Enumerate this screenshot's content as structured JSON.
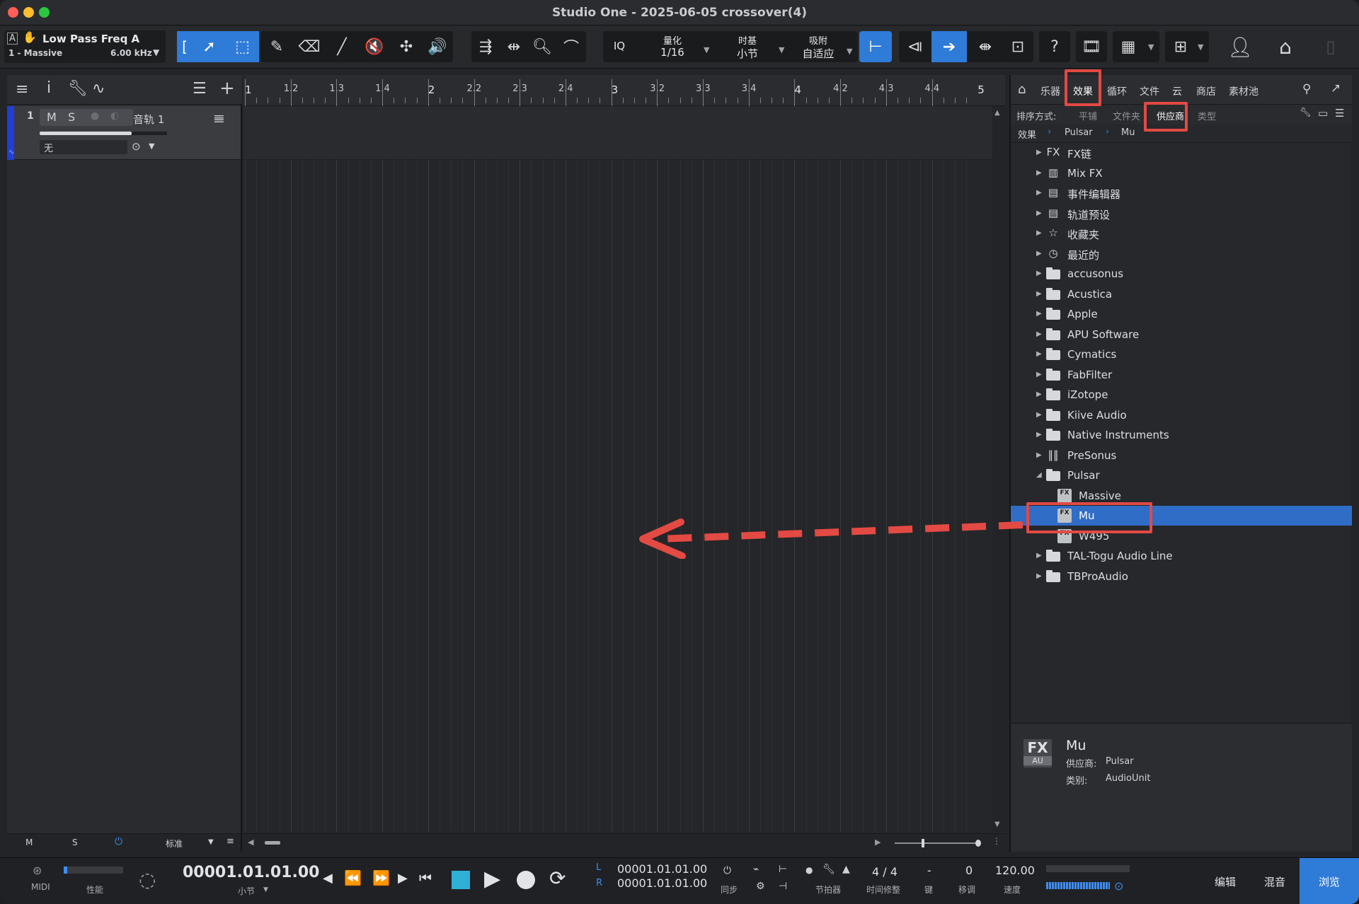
{
  "window": {
    "title": "Studio One - 2025-06-05 crossover(4)"
  },
  "toolbar": {
    "param_name": "Low Pass Freq A",
    "track_label": "1 - Massive",
    "param_value": "6.00 kHz",
    "iq": "IQ",
    "quantize_label": "量化",
    "quantize_value": "1/16",
    "timebase_label": "时基",
    "timebase_value": "小节",
    "snap_label": "吸附",
    "snap_value": "自适应"
  },
  "track": {
    "number": "1",
    "m": "M",
    "s": "S",
    "name": "音轨 1",
    "input": "无"
  },
  "left_footer": {
    "m": "M",
    "s": "S",
    "mode": "标准"
  },
  "ruler": {
    "labels": [
      "1",
      "1.2",
      "1.3",
      "1.4",
      "2",
      "2.2",
      "2.3",
      "2.4",
      "3",
      "3.2",
      "3.3",
      "3.4",
      "4",
      "4.2",
      "4.3",
      "4.4",
      "5"
    ]
  },
  "browser": {
    "tabs": [
      "乐器",
      "效果",
      "循环",
      "文件",
      "云",
      "商店",
      "素材池"
    ],
    "sort_label": "排序方式:",
    "sort_options": [
      "平铺",
      "文件夹",
      "供应商",
      "类型"
    ],
    "breadcrumb": [
      "效果",
      "Pulsar",
      "Mu"
    ],
    "items": [
      {
        "label": "FX链",
        "icon": "fx-chain-icon",
        "expanded": false
      },
      {
        "label": "Mix FX",
        "icon": "mixfx-icon",
        "expanded": false
      },
      {
        "label": "事件编辑器",
        "icon": "event-editor-icon",
        "expanded": false
      },
      {
        "label": "轨道预设",
        "icon": "track-preset-icon",
        "expanded": false
      },
      {
        "label": "收藏夹",
        "icon": "star-icon",
        "expanded": false
      },
      {
        "label": "最近的",
        "icon": "clock-icon",
        "expanded": false
      },
      {
        "label": "accusonus",
        "icon": "folder-icon"
      },
      {
        "label": "Acustica",
        "icon": "folder-icon"
      },
      {
        "label": "Apple",
        "icon": "folder-icon"
      },
      {
        "label": "APU Software",
        "icon": "folder-icon"
      },
      {
        "label": "Cymatics",
        "icon": "folder-icon"
      },
      {
        "label": "FabFilter",
        "icon": "folder-icon"
      },
      {
        "label": "iZotope",
        "icon": "folder-icon"
      },
      {
        "label": "Kiive Audio",
        "icon": "folder-icon"
      },
      {
        "label": "Native Instruments",
        "icon": "folder-icon"
      },
      {
        "label": "PreSonus",
        "icon": "presonus-icon"
      },
      {
        "label": "Pulsar",
        "icon": "folder-open-icon",
        "expanded": true
      },
      {
        "label": "Massive",
        "icon": "fx-plugin-icon",
        "child": true
      },
      {
        "label": "Mu",
        "icon": "fx-plugin-icon",
        "child": true,
        "selected": true
      },
      {
        "label": "W495",
        "icon": "fx-plugin-icon",
        "child": true
      },
      {
        "label": "TAL-Togu Audio Line",
        "icon": "folder-icon"
      },
      {
        "label": "TBProAudio",
        "icon": "folder-icon"
      }
    ],
    "info": {
      "badge_top": "FX",
      "badge_bottom": "AU",
      "name": "Mu",
      "vendor_label": "供应商:",
      "vendor": "Pulsar",
      "type_label": "类别:",
      "type": "AudioUnit"
    }
  },
  "transport": {
    "midi": "MIDI",
    "perf": "性能",
    "position": "00001.01.01.00",
    "position_unit": "小节",
    "loop_l": "00001.01.01.00",
    "loop_r": "00001.01.01.00",
    "L": "L",
    "R": "R",
    "sync": "同步",
    "metronome": "节拍器",
    "signature": "4 / 4",
    "signature_label": "时间修整",
    "key": "-",
    "key_label": "键",
    "transpose": "0",
    "transpose_label": "移调",
    "tempo": "120.00",
    "tempo_label": "速度",
    "btn_edit": "编辑",
    "btn_mix": "混音",
    "btn_browse": "浏览"
  },
  "colors": {
    "accent": "#2f7bd8",
    "annotation": "#e24a43",
    "selection": "#2f6dc7"
  }
}
